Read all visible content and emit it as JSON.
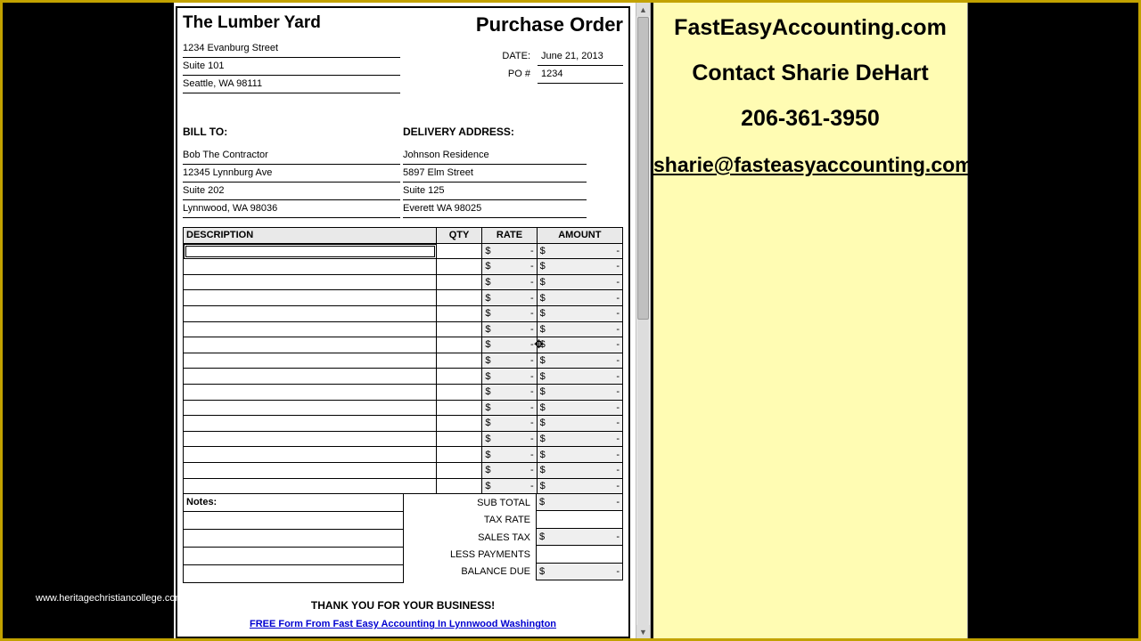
{
  "watermark": "www.heritagechristiancollege.com",
  "vendor": {
    "name": "The Lumber Yard",
    "street": "1234 Evanburg Street",
    "suite": "Suite 101",
    "city_state_zip": "Seattle, WA 98111"
  },
  "doc_title": "Purchase Order",
  "meta": {
    "date_label": "DATE:",
    "date_value": "June 21, 2013",
    "po_label": "PO #",
    "po_value": "1234"
  },
  "bill_to": {
    "heading": "BILL TO:",
    "line1": "Bob The Contractor",
    "line2": "12345 Lynnburg Ave",
    "line3": "Suite 202",
    "line4": "Lynnwood, WA 98036"
  },
  "ship_to": {
    "heading": "DELIVERY ADDRESS:",
    "line1": "Johnson Residence",
    "line2": "5897 Elm Street",
    "line3": "Suite 125",
    "line4": "Everett WA 98025"
  },
  "columns": {
    "desc": "DESCRIPTION",
    "qty": "QTY",
    "rate": "RATE",
    "amount": "AMOUNT"
  },
  "currency": "$",
  "dash": "-",
  "row_count": 16,
  "notes_label": "Notes:",
  "totals": {
    "subtotal": "SUB TOTAL",
    "taxrate": "TAX RATE",
    "salestax": "SALES TAX",
    "lesspay": "LESS PAYMENTS",
    "balance": "BALANCE DUE"
  },
  "thanks": "THANK YOU FOR YOUR BUSINESS!",
  "free_link": "FREE Form From Fast Easy Accounting In Lynnwood Washington",
  "panel": {
    "l1": "FastEasyAccounting.com",
    "l2": "Contact Sharie DeHart",
    "l3": "206-361-3950",
    "l4": "sharie@fasteasyaccounting.com"
  }
}
